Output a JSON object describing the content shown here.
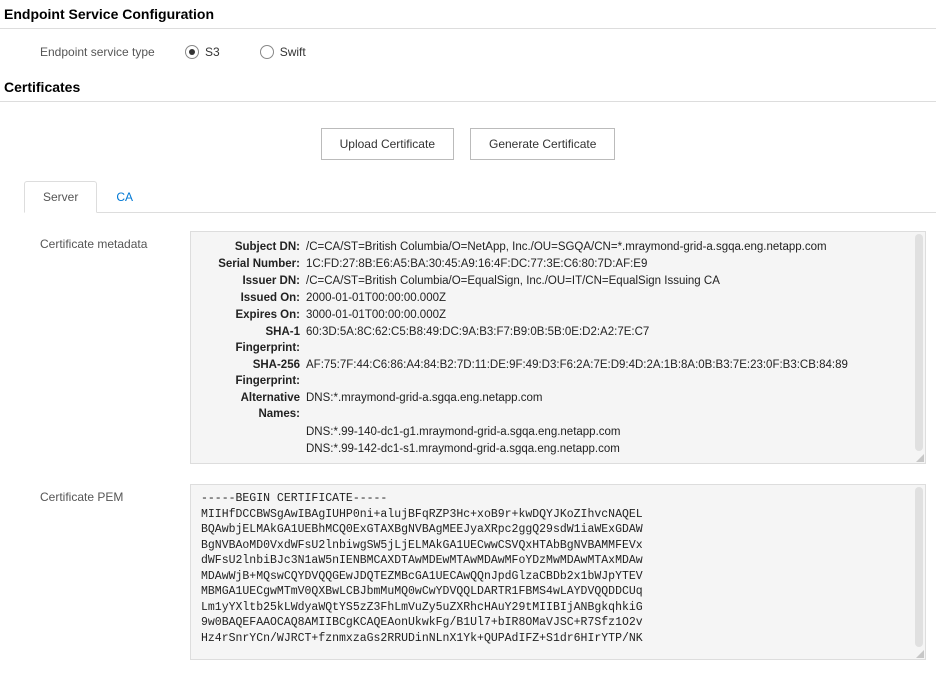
{
  "endpoint_section": {
    "title": "Endpoint Service Configuration",
    "type_label": "Endpoint service type",
    "options": {
      "s3": "S3",
      "swift": "Swift"
    }
  },
  "certificates_section": {
    "title": "Certificates",
    "buttons": {
      "upload": "Upload Certificate",
      "generate": "Generate Certificate"
    }
  },
  "tabs": {
    "server": "Server",
    "ca": "CA"
  },
  "server_tab": {
    "metadata_label": "Certificate metadata",
    "pem_label": "Certificate PEM",
    "metadata": {
      "subject_dn_key": "Subject DN:",
      "subject_dn_val": "/C=CA/ST=British Columbia/O=NetApp, Inc./OU=SGQA/CN=*.mraymond-grid-a.sgqa.eng.netapp.com",
      "serial_key": "Serial Number:",
      "serial_val": "1C:FD:27:8B:E6:A5:BA:30:45:A9:16:4F:DC:77:3E:C6:80:7D:AF:E9",
      "issuer_dn_key": "Issuer DN:",
      "issuer_dn_val": "/C=CA/ST=British Columbia/O=EqualSign, Inc./OU=IT/CN=EqualSign Issuing CA",
      "issued_on_key": "Issued On:",
      "issued_on_val": "2000-01-01T00:00:00.000Z",
      "expires_on_key": "Expires On:",
      "expires_on_val": "3000-01-01T00:00:00.000Z",
      "sha1_key": "SHA-1 Fingerprint:",
      "sha1_val": "60:3D:5A:8C:62:C5:B8:49:DC:9A:B3:F7:B9:0B:5B:0E:D2:A2:7E:C7",
      "sha256_key": "SHA-256 Fingerprint:",
      "sha256_val": "AF:75:7F:44:C6:86:A4:84:B2:7D:11:DE:9F:49:D3:F6:2A:7E:D9:4D:2A:1B:8A:0B:B3:7E:23:0F:B3:CB:84:89",
      "altnames_key": "Alternative Names:",
      "altnames_val1": "DNS:*.mraymond-grid-a.sgqa.eng.netapp.com",
      "altnames_val2": "DNS:*.99-140-dc1-g1.mraymond-grid-a.sgqa.eng.netapp.com",
      "altnames_val3": "DNS:*.99-142-dc1-s1.mraymond-grid-a.sgqa.eng.netapp.com"
    },
    "pem": "-----BEGIN CERTIFICATE-----\nMIIHfDCCBWSgAwIBAgIUHP0ni+alujBFqRZP3Hc+xoB9r+kwDQYJKoZIhvcNAQEL\nBQAwbjELMAkGA1UEBhMCQ0ExGTAXBgNVBAgMEEJyaXRpc2ggQ29sdW1iaWExGDAW\nBgNVBAoMD0VxdWFsU2lnbiwgSW5jLjELMAkGA1UECwwCSVQxHTAbBgNVBAMMFEVx\ndWFsU2lnbiBJc3N1aW5nIENBMCAXDTAwMDEwMTAwMDAwMFoYDzMwMDAwMTAxMDAw\nMDAwWjB+MQswCQYDVQQGEwJDQTEZMBcGA1UECAwQQnJpdGlzaCBDb2x1bWJpYTEV\nMBMGA1UECgwMTmV0QXBwLCBJbmMuMQ0wCwYDVQQLDARTR1FBMS4wLAYDVQQDDCUq\nLm1yYXltb25kLWdyaWQtYS5zZ3FhLmVuZy5uZXRhcHAuY29tMIIBIjANBgkqhkiG\n9w0BAQEFAAOCAQ8AMIIBCgKCAQEAonUkwkFg/B1Ul7+bIR8OMaVJSC+R7Sfz1O2v\nHz4rSnrYCn/WJRCT+fznmxzaGs2RRUDinNLnX1Yk+QUPAdIFZ+S1dr6HIrYTP/NK"
  }
}
